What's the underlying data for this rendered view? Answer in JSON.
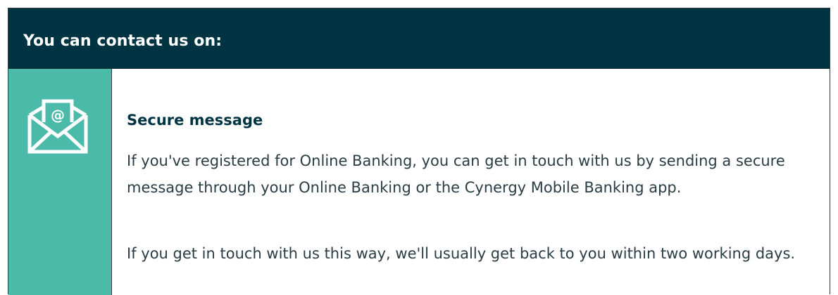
{
  "header": {
    "title": "You can contact us on:"
  },
  "icon": {
    "name": "email-envelope-icon",
    "color": "#ffffff",
    "background": "#4cbaa9"
  },
  "section": {
    "title": "Secure message",
    "paragraphs": [
      "If you've registered for Online Banking, you can get in touch with us by sending a secure message through your Online Banking or the Cynergy Mobile Banking app.",
      "If you get in touch with us this way, we'll usually get back to you within two working days."
    ]
  },
  "colors": {
    "header_bg": "#013443",
    "accent": "#4cbaa9",
    "title_text": "#013443",
    "body_text": "#2b3d44"
  }
}
